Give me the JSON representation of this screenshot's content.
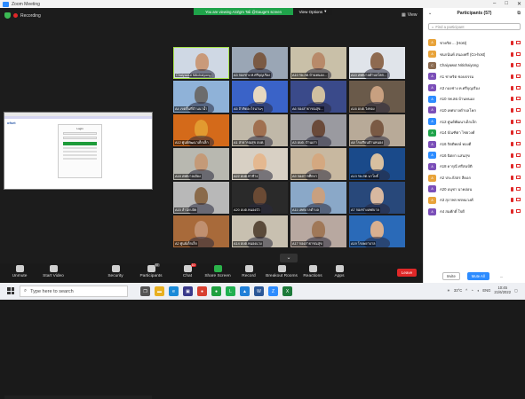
{
  "window": {
    "title": "Zoom Meeting",
    "min_icon": "minimize-icon",
    "max_icon": "maximize-icon",
    "close_icon": "close-icon"
  },
  "meeting": {
    "recording_label": "Recording",
    "share_banner": "You are viewing A2Zgm Tali @Gauge's screen",
    "view_options": "View Options",
    "view_label": "View",
    "more_label": "⌄"
  },
  "shared_screen": {
    "logo": "ofset",
    "card_title": "Login"
  },
  "tiles": [
    {
      "name": "Chaiyawut Nitichaiyong",
      "bg": "#cfd8e4",
      "face": "#c99a7a"
    },
    {
      "name": "A3 กองช่าง ท.ศรีบุญเรือง",
      "bg": "#9aa6b5",
      "face": "#7a5a44"
    },
    {
      "name": "A10 รพ.สต.บ้านหนอง...",
      "bg": "#c9c0a8",
      "face": "#b88a6a"
    },
    {
      "name": "A10 เทศบาลตำบลโคก...",
      "bg": "#e0e4ea",
      "face": "#8e6a50"
    },
    {
      "name": "A4 เขตพื้นที่บ้านนาน้ำ",
      "bg": "#8fb2d8",
      "face": "#6c6c6c"
    },
    {
      "name": "A5 ถ้าคิดอะไรนานๆ",
      "bg": "#3a63c8",
      "face": "#e6d8c0"
    },
    {
      "name": "A6 กองสาธารณสุข...",
      "bg": "#3a4a8a",
      "face": "#d0c0a0"
    },
    {
      "name": "A16 อบต.วังทอง",
      "bg": "#6a5a4a",
      "face": "#c8a080"
    },
    {
      "name": "A12 ศูนย์พัฒนาเด็กเล็ก",
      "bg": "#d46a1a",
      "face": "#e29a30"
    },
    {
      "name": "A1 สาธารณสุข อบต.",
      "bg": "#c0b8a8",
      "face": "#a07050"
    },
    {
      "name": "A3 อบต. บ้านเก่า",
      "bg": "#9a9aa0",
      "face": "#6a4a3a"
    },
    {
      "name": "A8 โรงเรียนบ้านหนอง",
      "bg": "#b8aa98",
      "face": "#7a5a44"
    },
    {
      "name": "A18 เทศบาลเมือง",
      "bg": "#b8b8b0",
      "face": "#c49a78"
    },
    {
      "name": "A22 อบต.ท่าช้าง",
      "bg": "#d8d0c4",
      "face": "#e4b890"
    },
    {
      "name": "A9 กองการศึกษา",
      "bg": "#c8b8a0",
      "face": "#d4a880"
    },
    {
      "name": "A13 รพ.สต.นาโพธิ์",
      "bg": "#1a4a8a",
      "face": "#d8c0a0"
    },
    {
      "name": "A15 สำนักปลัด",
      "bg": "#b8b8b8",
      "face": "#8a6a4a"
    },
    {
      "name": "A20 อบต.หนองบัว",
      "bg": "#2a2a2a",
      "face": "#6a4a34"
    },
    {
      "name": "A11 เทศบาลตำบล",
      "bg": "#8aa8c8",
      "face": "#c8a080"
    },
    {
      "name": "A7 กองช่างเทศบาล",
      "bg": "#28487a",
      "face": "#d8b8a0"
    },
    {
      "name": "A2 ศูนย์เด็กเล็ก",
      "bg": "#a86a3a",
      "face": "#c09070"
    },
    {
      "name": "A14 อบต.หนองแวง",
      "bg": "#c8c0b0",
      "face": "#5a4a3a"
    },
    {
      "name": "A17 กองสาธารณสุข",
      "bg": "#b8a8a0",
      "face": "#a07858"
    },
    {
      "name": "A19 โรงพยาบาล",
      "bg": "#2a6ab8",
      "face": "#d8b090"
    }
  ],
  "toolbar": {
    "unmute": "Unmute",
    "start_video": "Start Video",
    "security": "Security",
    "participants": "Participants",
    "participants_count": "57",
    "chat": "Chat",
    "chat_badge": "10",
    "share_screen": "Share Screen",
    "record": "Record",
    "breakout": "Breakout Rooms",
    "reactions": "Reactions",
    "apps": "Apps",
    "end": "Leave"
  },
  "panel": {
    "title": "Participants (57)",
    "search_placeholder": "Find a participant",
    "participants": [
      {
        "initials": "A",
        "color": "#e8a33a",
        "name": "ชาคริต ... (Host)"
      },
      {
        "initials": "A",
        "color": "#e8a33a",
        "name": "ชนกนันท์ สนองศรี (Co-host)"
      },
      {
        "initials": "C",
        "color": "#8a6a50",
        "name": "Chaiyawut Nitichaiyong"
      },
      {
        "initials": "A",
        "color": "#7b4fb8",
        "name": "A1 ชาคริต ชอบธรรม"
      },
      {
        "initials": "A",
        "color": "#7b4fb8",
        "name": "A3 กองช่าง ท.ศรีบุญเรือง"
      },
      {
        "initials": "A",
        "color": "#2d8cff",
        "name": "A10 รพ.สต.บ้านหนอง"
      },
      {
        "initials": "A",
        "color": "#7b4fb8",
        "name": "A10 เทศบาลตำบลโคก"
      },
      {
        "initials": "A",
        "color": "#2d8cff",
        "name": "A12 ศูนย์พัฒนาเด็กเล็ก"
      },
      {
        "initials": "A",
        "color": "#1fa34a",
        "name": "A14 บัณฑิตา ไชยวงศ์"
      },
      {
        "initials": "A",
        "color": "#7b4fb8",
        "name": "A16 กิตติพงษ์ ทองดี"
      },
      {
        "initials": "A",
        "color": "#2d8cff",
        "name": "A16 นิตยา แสนสุข"
      },
      {
        "initials": "A",
        "color": "#7b4fb8",
        "name": "A18 ดารุณี ศรีสมบัติ"
      },
      {
        "initials": "A",
        "color": "#e8a33a",
        "name": "A2 ประภัสสร สีดอก"
      },
      {
        "initials": "A",
        "color": "#7b4fb8",
        "name": "A20 อนุชา นาคอ่อน"
      },
      {
        "initials": "A",
        "color": "#e8a33a",
        "name": "A3 สุภาพร พรหมวงศ์"
      },
      {
        "initials": "A",
        "color": "#7b4fb8",
        "name": "A4 สมศักดิ์ ใจดี"
      }
    ],
    "invite": "Invite",
    "mute_all": "Mute All",
    "more": "..."
  },
  "taskbar": {
    "search_placeholder": "Type here to search",
    "weather": "33°C",
    "lang": "ENG",
    "time": "10:45",
    "date": "21/6/2022",
    "apps": [
      {
        "icon": "task-view-icon",
        "color": "#555",
        "glyph": "❐"
      },
      {
        "icon": "file-explorer-icon",
        "color": "#e8b020",
        "glyph": "▬"
      },
      {
        "icon": "edge-icon",
        "color": "#1a8ad8",
        "glyph": "e"
      },
      {
        "icon": "store-icon",
        "color": "#3a3a8a",
        "glyph": "▣"
      },
      {
        "icon": "chrome-icon",
        "color": "#d84030",
        "glyph": "●"
      },
      {
        "icon": "chrome-2-icon",
        "color": "#20a040",
        "glyph": "●"
      },
      {
        "icon": "line-icon",
        "color": "#20b050",
        "glyph": "L"
      },
      {
        "icon": "photos-icon",
        "color": "#2080d8",
        "glyph": "▲"
      },
      {
        "icon": "word-icon",
        "color": "#2b5797",
        "glyph": "W"
      },
      {
        "icon": "zoom-icon",
        "color": "#2d8cff",
        "glyph": "Z"
      },
      {
        "icon": "excel-icon",
        "color": "#1d7a3a",
        "glyph": "X"
      }
    ]
  }
}
